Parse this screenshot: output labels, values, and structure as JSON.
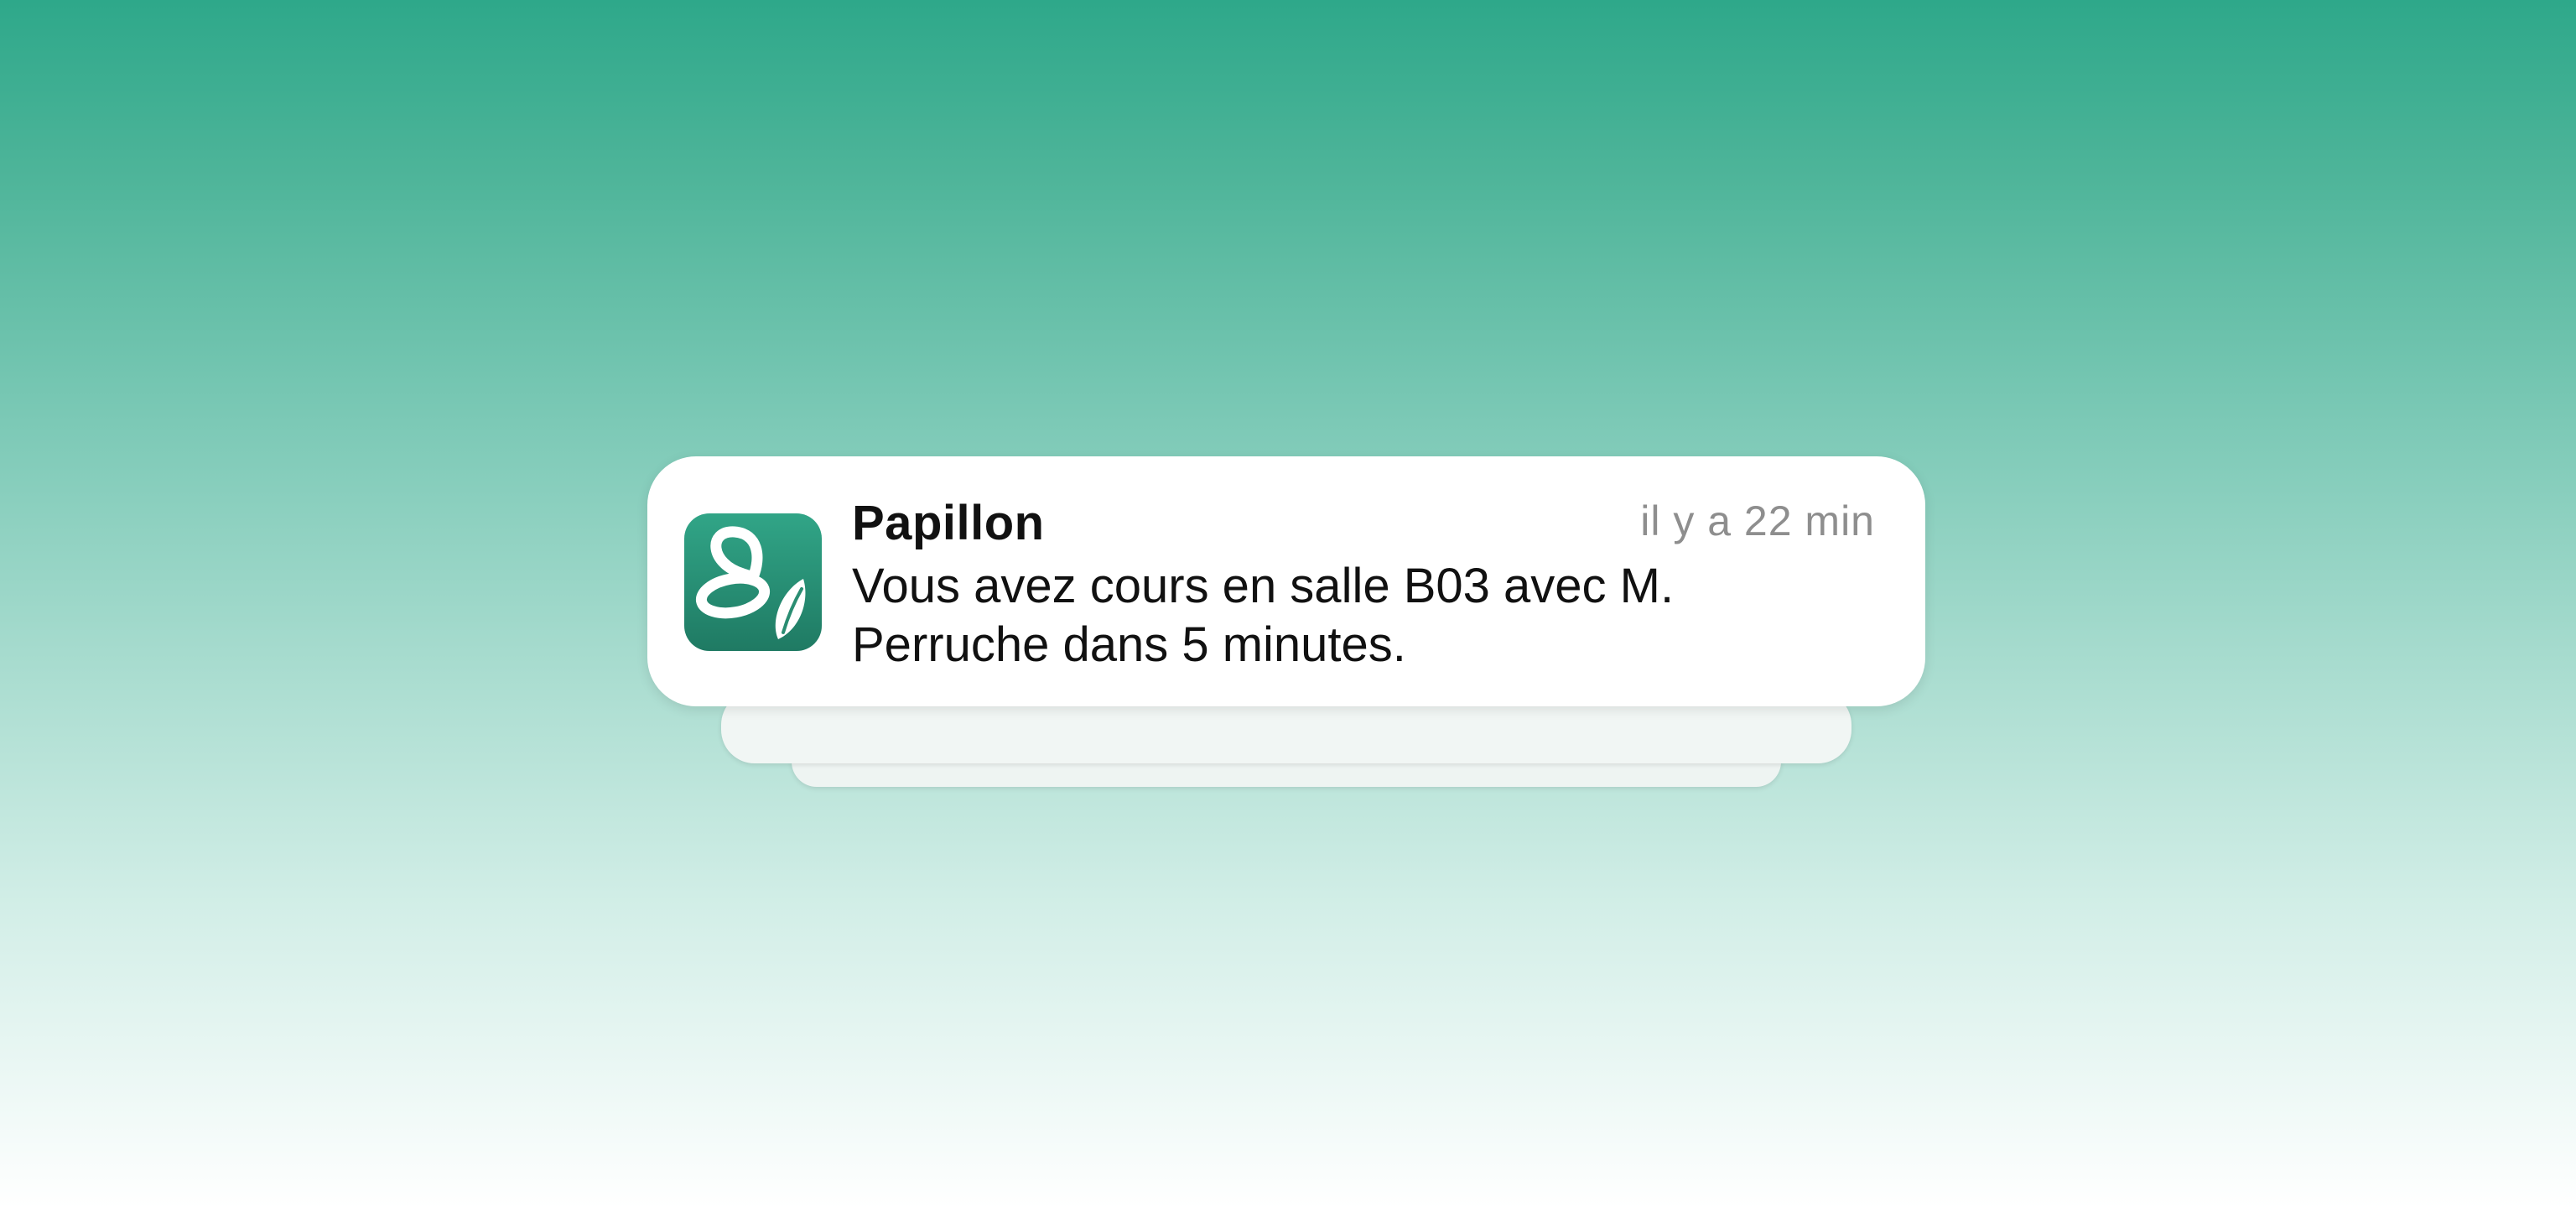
{
  "background": {
    "gradient_top": "#2ea88a",
    "gradient_bottom": "#ffffff"
  },
  "notification": {
    "app_name": "Papillon",
    "timestamp": "il y a 22 min",
    "message": "Vous avez cours en salle B03 avec M. Perruche dans 5 minutes.",
    "icon": "papillon-butterfly-icon",
    "icon_color": "#2a9478"
  },
  "stacked_notifications": 2
}
